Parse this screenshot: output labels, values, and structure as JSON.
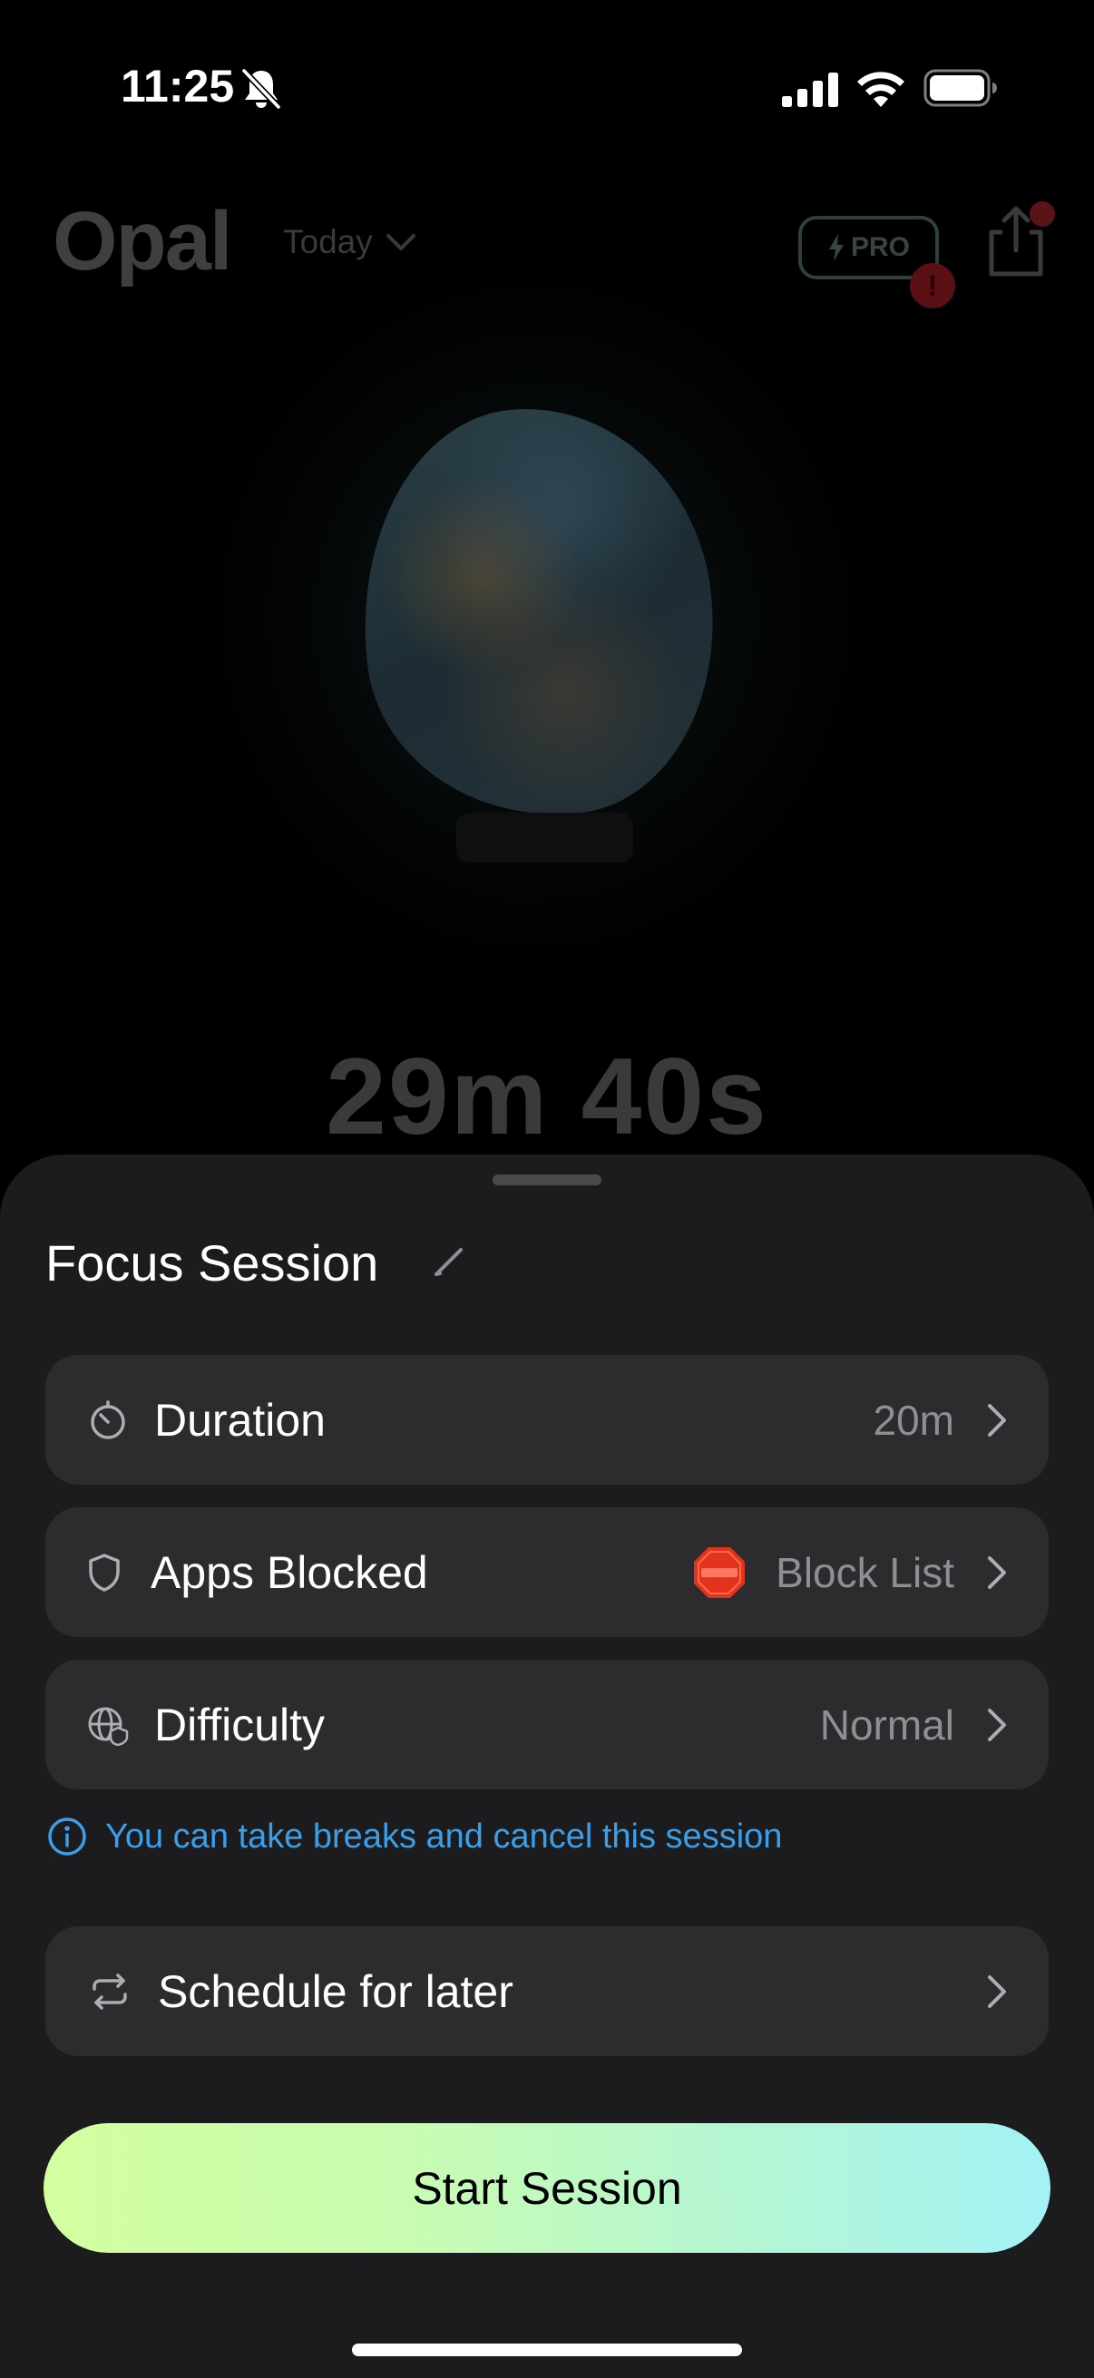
{
  "status_bar": {
    "time": "11:25",
    "icons": [
      "bell-slash-icon",
      "cellular-signal-icon",
      "wifi-icon",
      "battery-icon"
    ]
  },
  "header": {
    "logo": "Opal",
    "date_filter": "Today",
    "pro_label": "PRO"
  },
  "timer": {
    "remaining": "29m 40s"
  },
  "sheet": {
    "title": "Focus Session",
    "rows": [
      {
        "label": "Duration",
        "value": "20m",
        "icon": "timer-icon"
      },
      {
        "label": "Apps Blocked",
        "value": "Block List",
        "icon": "shield-icon",
        "value_icon": "stop-sign-emoji"
      },
      {
        "label": "Difficulty",
        "value": "Normal",
        "icon": "globe-shield-icon"
      }
    ],
    "info_text": "You can take breaks and cancel this session",
    "schedule_label": "Schedule for later",
    "start_label": "Start Session"
  },
  "colors": {
    "background": "#000000",
    "sheet": "#1c1c1e",
    "row": "#2c2c2e",
    "info": "#3a9fe8",
    "button_gradient_start": "#d4ffa0",
    "button_gradient_end": "#a4f2f6"
  }
}
